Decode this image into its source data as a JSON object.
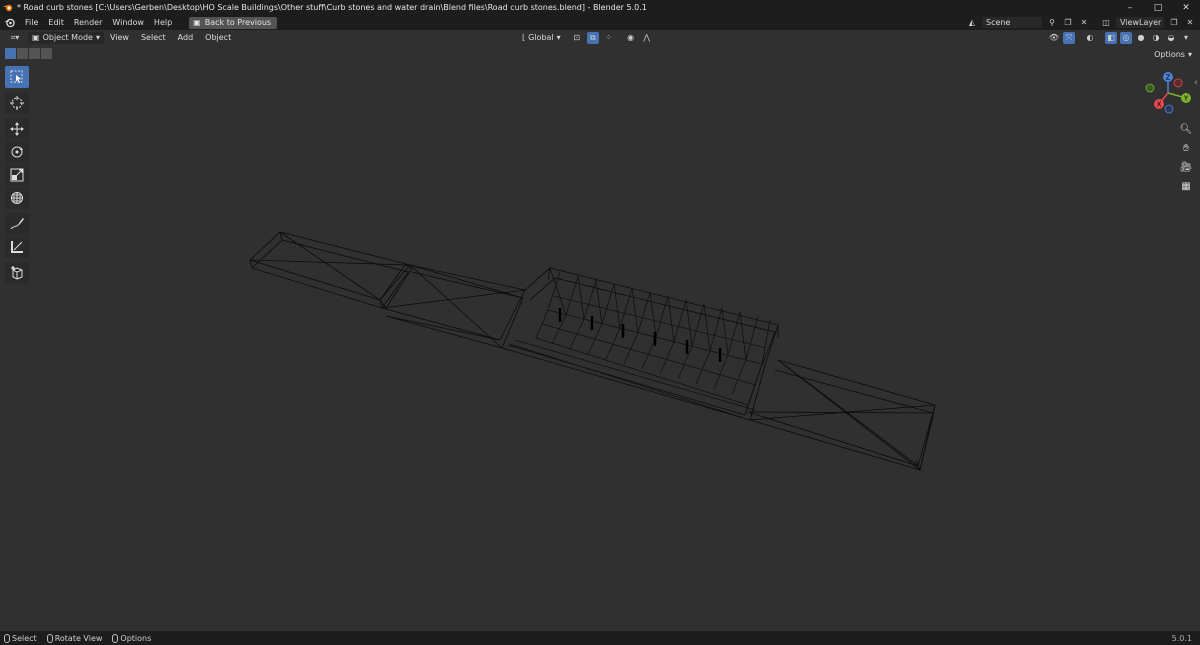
{
  "window": {
    "title": "* Road curb stones [C:\\Users\\Gerben\\Desktop\\HO Scale Buildings\\Other stuff\\Curb stones and water drain\\Blend files\\Road curb stones.blend] - Blender 5.0.1",
    "minimize": "–",
    "maximize": "□",
    "close": "✕"
  },
  "menu": {
    "items": [
      "File",
      "Edit",
      "Render",
      "Window",
      "Help"
    ],
    "back_button": "Back to Previous",
    "scene": "Scene",
    "view_layer": "ViewLayer"
  },
  "viewport_header": {
    "mode": "Object Mode",
    "menus": [
      "View",
      "Select",
      "Add",
      "Object"
    ],
    "orientation": "Global",
    "options": "Options"
  },
  "tools": [
    "select-box",
    "cursor",
    "move",
    "rotate",
    "scale",
    "transform",
    "annotate",
    "measure",
    "add-cube"
  ],
  "gizmo": {
    "z": "Z",
    "y": "Y",
    "x": "X"
  },
  "status": {
    "items": [
      "Select",
      "Rotate View",
      "Options"
    ],
    "version": "5.0.1"
  },
  "colors": {
    "accent": "#4772b3",
    "background": "#303030",
    "header": "#1d1d1d",
    "axis_x": "#e5484d",
    "axis_y": "#7bb32e",
    "axis_z": "#4e82d6"
  }
}
